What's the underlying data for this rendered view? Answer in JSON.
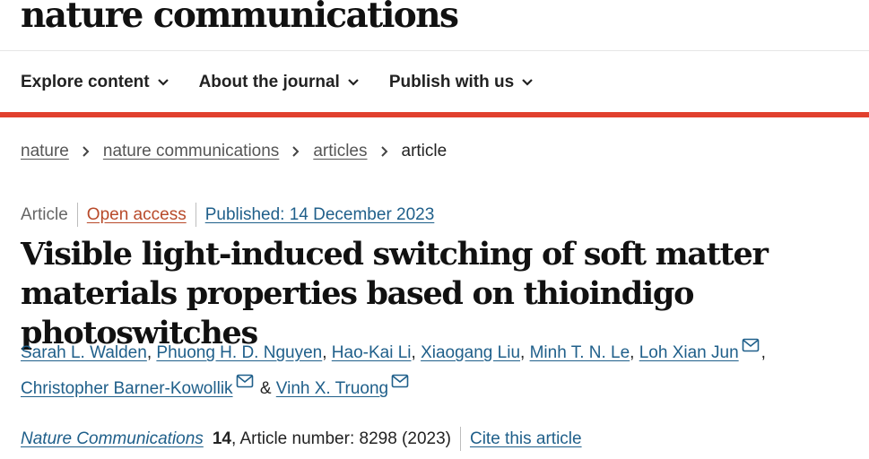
{
  "header": {
    "brand": "nature communications"
  },
  "nav": {
    "items": [
      {
        "label": "Explore content",
        "icon": "chevron-down-icon"
      },
      {
        "label": "About the journal",
        "icon": "chevron-down-icon"
      },
      {
        "label": "Publish with us",
        "icon": "chevron-down-icon"
      }
    ]
  },
  "colors": {
    "accent_bar": "#e1402e",
    "link": "#1f5f8a",
    "open_access": "#b84a2a"
  },
  "breadcrumb": {
    "items": [
      "nature",
      "nature communications",
      "articles"
    ],
    "current": "article"
  },
  "meta": {
    "type": "Article",
    "open_access": "Open access",
    "published": "Published: 14 December 2023"
  },
  "article": {
    "title": "Visible light-induced switching of soft matter materials properties based on thioindigo photoswitches",
    "authors": [
      {
        "name": "Sarah L. Walden",
        "sep": ", "
      },
      {
        "name": "Phuong H. D. Nguyen",
        "sep": ", "
      },
      {
        "name": "Hao-Kai Li",
        "sep": ", "
      },
      {
        "name": "Xiaogang Liu",
        "sep": ", "
      },
      {
        "name": "Minh T. N. Le",
        "sep": ", "
      },
      {
        "name": "Loh Xian Jun",
        "sep": ", "
      },
      {
        "name": "Christopher Barner-Kowollik",
        "sep": " & "
      },
      {
        "name": "Vinh X. Truong",
        "sep": ""
      }
    ]
  },
  "citation": {
    "journal": "Nature Communications",
    "volume": "14",
    "article_number": ", Article number: 8298 (2023)",
    "cite_label": "Cite this article"
  }
}
